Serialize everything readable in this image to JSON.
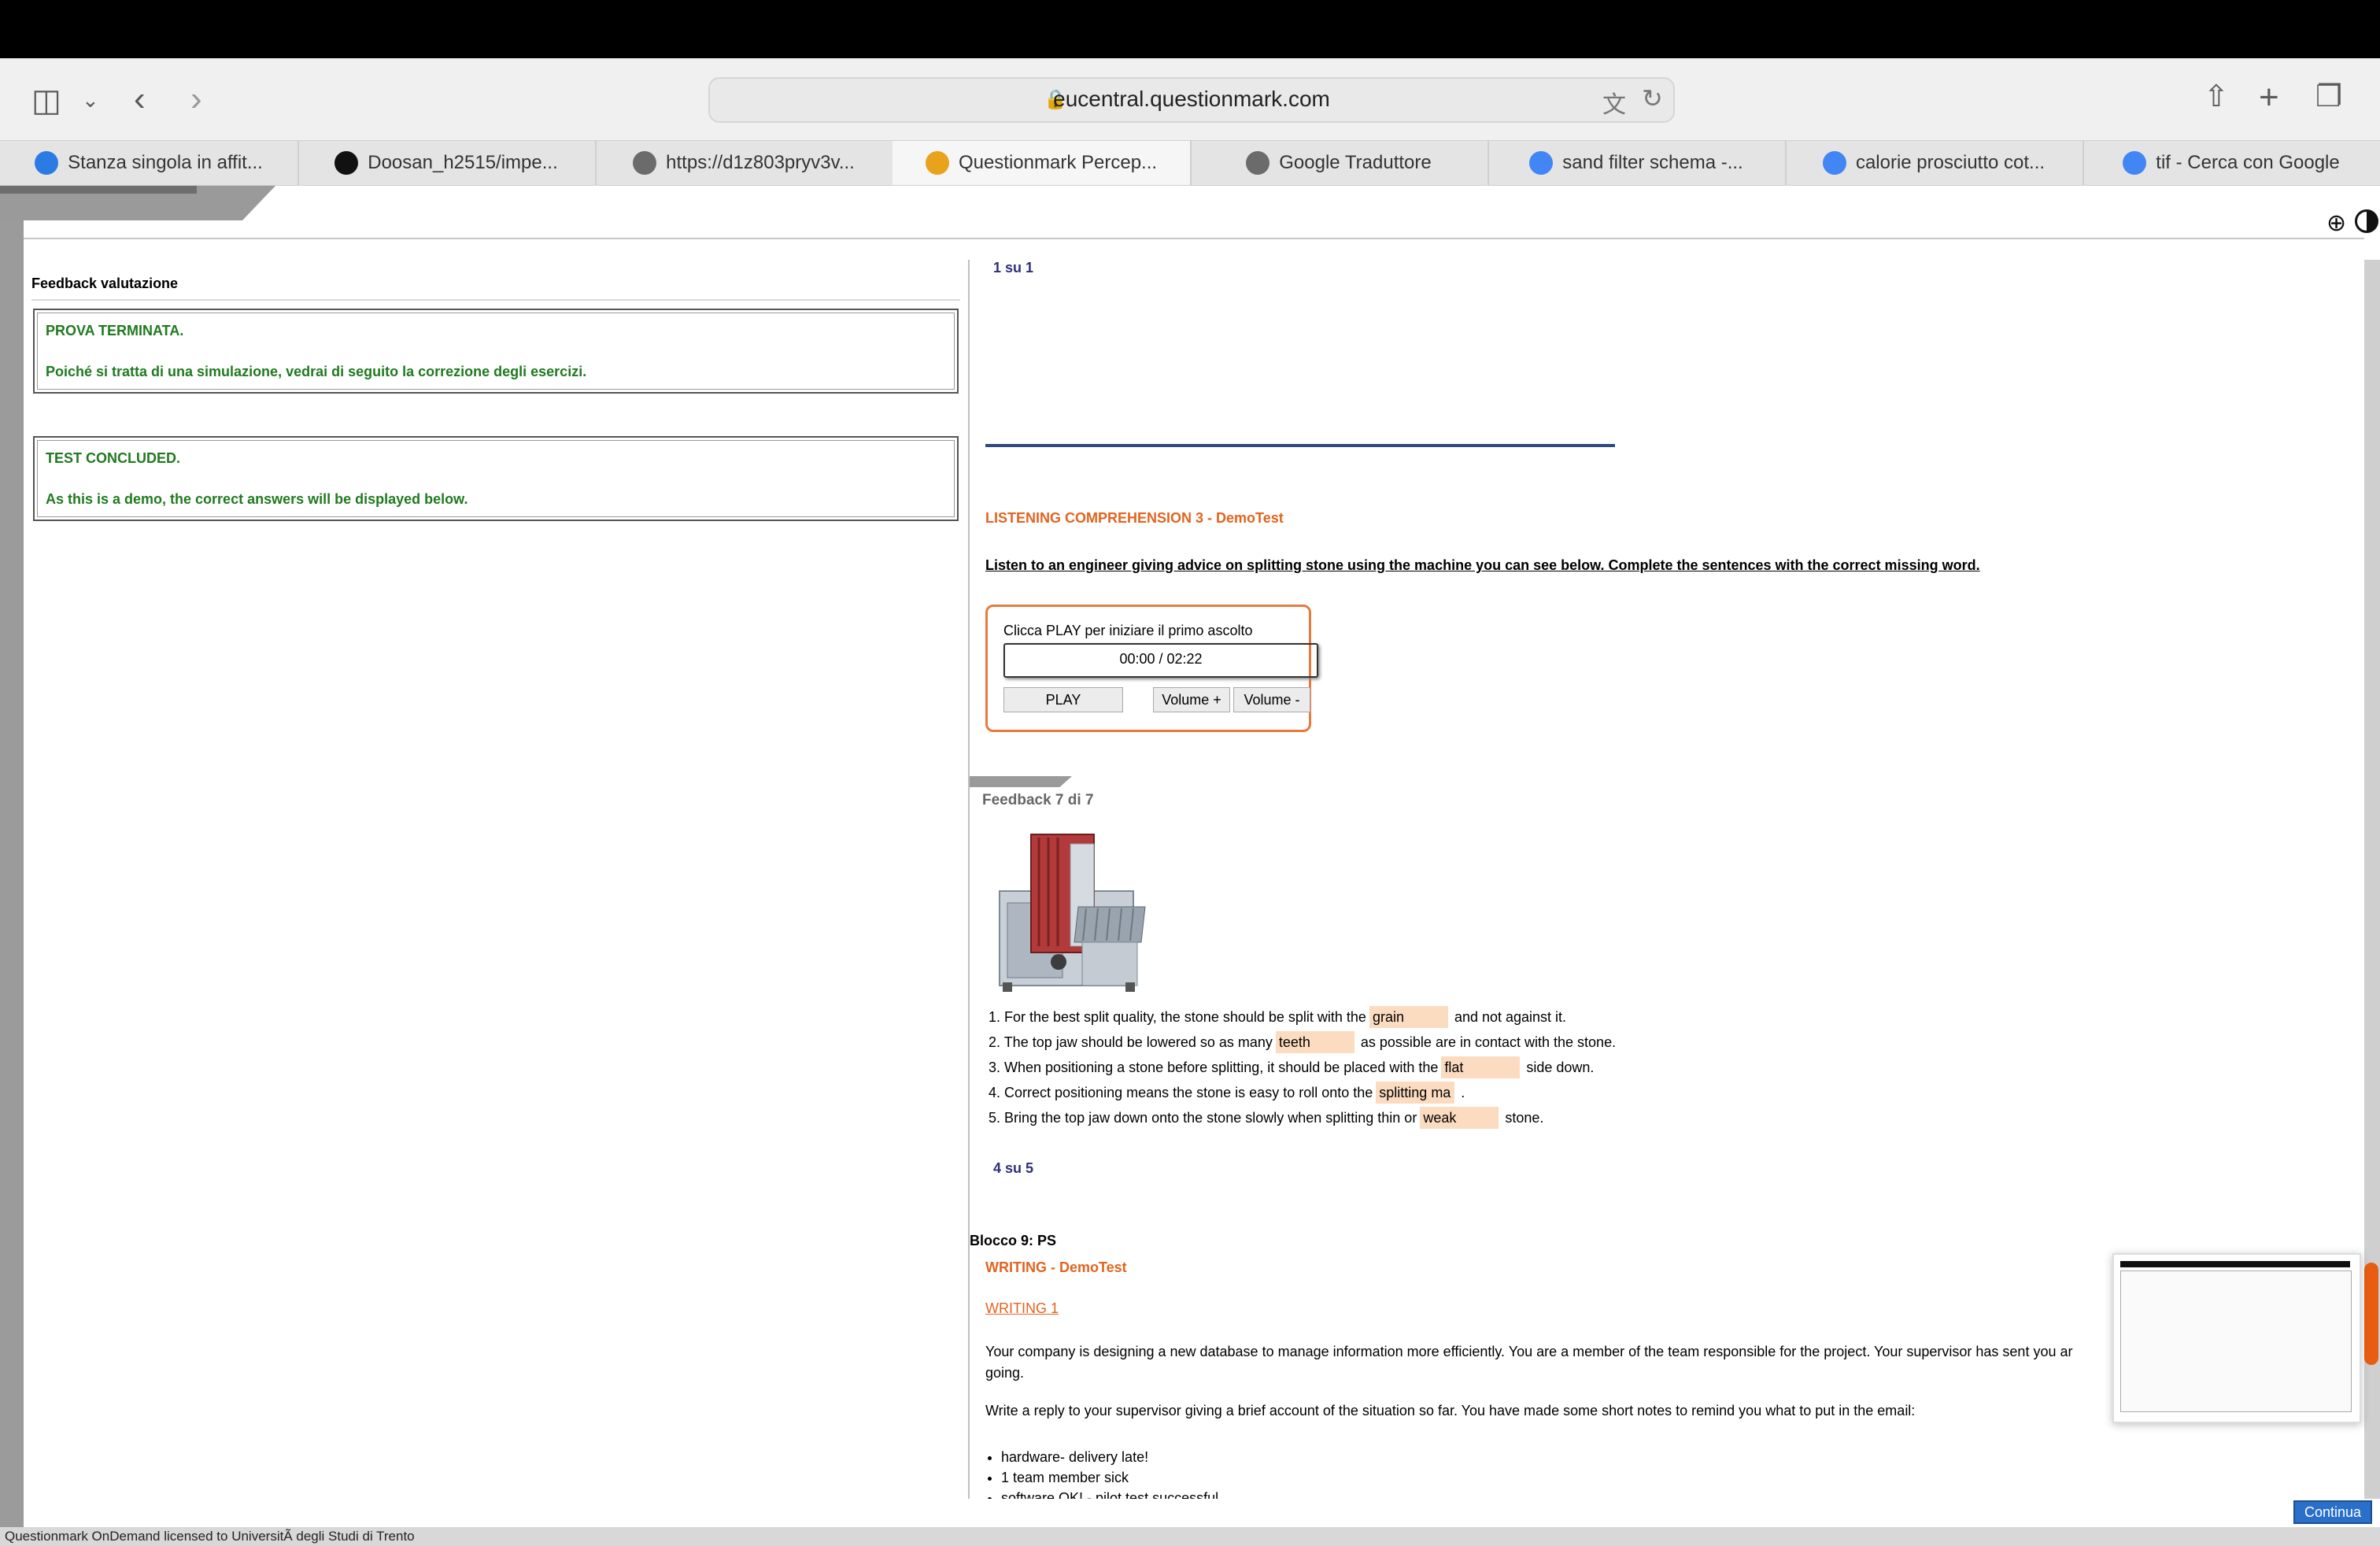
{
  "browser": {
    "url": "eucentral.questionmark.com",
    "tabs": [
      {
        "label": "Stanza singola in affit...",
        "icon": "info-icon",
        "color": "#2c7be5"
      },
      {
        "label": "Doosan_h2515/impe...",
        "icon": "github-icon",
        "color": "#111111"
      },
      {
        "label": "https://d1z803pryv3v...",
        "icon": "c-icon",
        "color": "#6b6b6b"
      },
      {
        "label": "Questionmark Percep...",
        "icon": "questionmark-icon",
        "color": "#e8a21b"
      },
      {
        "label": "Google Traduttore",
        "icon": "g-icon",
        "color": "#6b6b6b"
      },
      {
        "label": "sand filter schema -...",
        "icon": "google-icon",
        "color": "#4285f4"
      },
      {
        "label": "calorie prosciutto cot...",
        "icon": "google-icon",
        "color": "#4285f4"
      },
      {
        "label": "tif - Cerca con Google",
        "icon": "google-icon",
        "color": "#4285f4"
      }
    ]
  },
  "left_panel": {
    "title": "Feedback valutazione",
    "box_it": {
      "line1": "PROVA TERMINATA.",
      "line2": "Poiché si tratta di una simulazione, vedrai di seguito la correzione degli esercizi."
    },
    "box_en": {
      "line1": "TEST CONCLUDED.",
      "line2": "As this is a demo, the correct answers will be displayed below."
    },
    "text_color": "#1f7a1f"
  },
  "right_panel": {
    "counter_top": "1  su  1",
    "section_title": "LISTENING COMPREHENSION 3 - DemoTest",
    "instructions": "Listen to an engineer giving advice on splitting stone using the machine you can see below. Complete the sentences with the correct missing word.",
    "player": {
      "label": "Clicca PLAY per iniziare il primo ascolto",
      "time": "00:00 / 02:22",
      "play": "PLAY",
      "volume_up": "Volume +",
      "volume_down": "Volume -"
    },
    "feedback_title": "Feedback 7 di  7",
    "sentences": [
      {
        "before": "1. For the best split quality, the stone should be split with the",
        "answer": "grain",
        "after": "and not against it."
      },
      {
        "before": "2. The top jaw should be lowered so as many",
        "answer": "teeth",
        "after": "as possible are in contact with the stone."
      },
      {
        "before": "3. When positioning a stone before splitting, it should be placed with the",
        "answer": "flat",
        "after": "side down."
      },
      {
        "before": "4. Correct positioning means the stone is easy to roll onto the",
        "answer": "splitting ma",
        "after": "."
      },
      {
        "before": "5. Bring the top jaw down onto the stone slowly when splitting thin or",
        "answer": "weak",
        "after": "stone."
      }
    ],
    "counter_mid": "4  su  5",
    "block_label": "Blocco 9: PS",
    "writing_title": "WRITING - DemoTest",
    "writing_link": "WRITING 1",
    "writing_p1": "Your company is designing a new database to manage information more efficiently. You are a member of the team responsible for the project. Your supervisor has sent you ar going.",
    "writing_p2": "Write a reply to your supervisor giving a brief account of the situation so far. You have made some short notes to remind you what to put in the email:",
    "bullets": [
      "hardware- delivery late!",
      "1 team member sick",
      "software OK! - pilot test successful"
    ]
  },
  "footer": {
    "continue": "Continua",
    "status": "Questionmark OnDemand licensed to UniversitÃ  degli Studi di Trento"
  },
  "accent_orange": "#e2641f",
  "accent_navy": "#2f2f7a"
}
